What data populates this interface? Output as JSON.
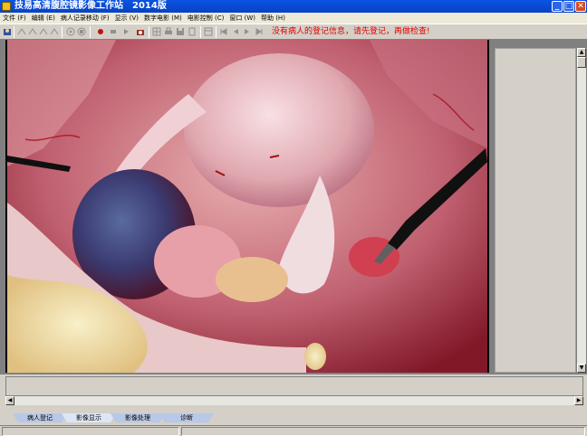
{
  "window": {
    "title": "技易高清腹腔镜影像工作站　2014版",
    "minimize": "_",
    "maximize": "□",
    "close": "✕"
  },
  "menu": [
    "文件 (F)",
    "编辑 (E)",
    "病人记录移动 (F)",
    "显示 (V)",
    "数字电影 (M)",
    "电影控制 (C)",
    "窗口 (W)",
    "帮助 (H)"
  ],
  "toolbar": {
    "notice": "没有病人的登记信息，请先登记，再做检查!"
  },
  "tabs": [
    {
      "label": "病人登记",
      "active": false
    },
    {
      "label": "影像显示",
      "active": true
    },
    {
      "label": "影像处理",
      "active": false
    },
    {
      "label": "诊断",
      "active": false
    }
  ],
  "scroll": {
    "up": "▲",
    "down": "▼",
    "left": "◀",
    "right": "▶"
  }
}
